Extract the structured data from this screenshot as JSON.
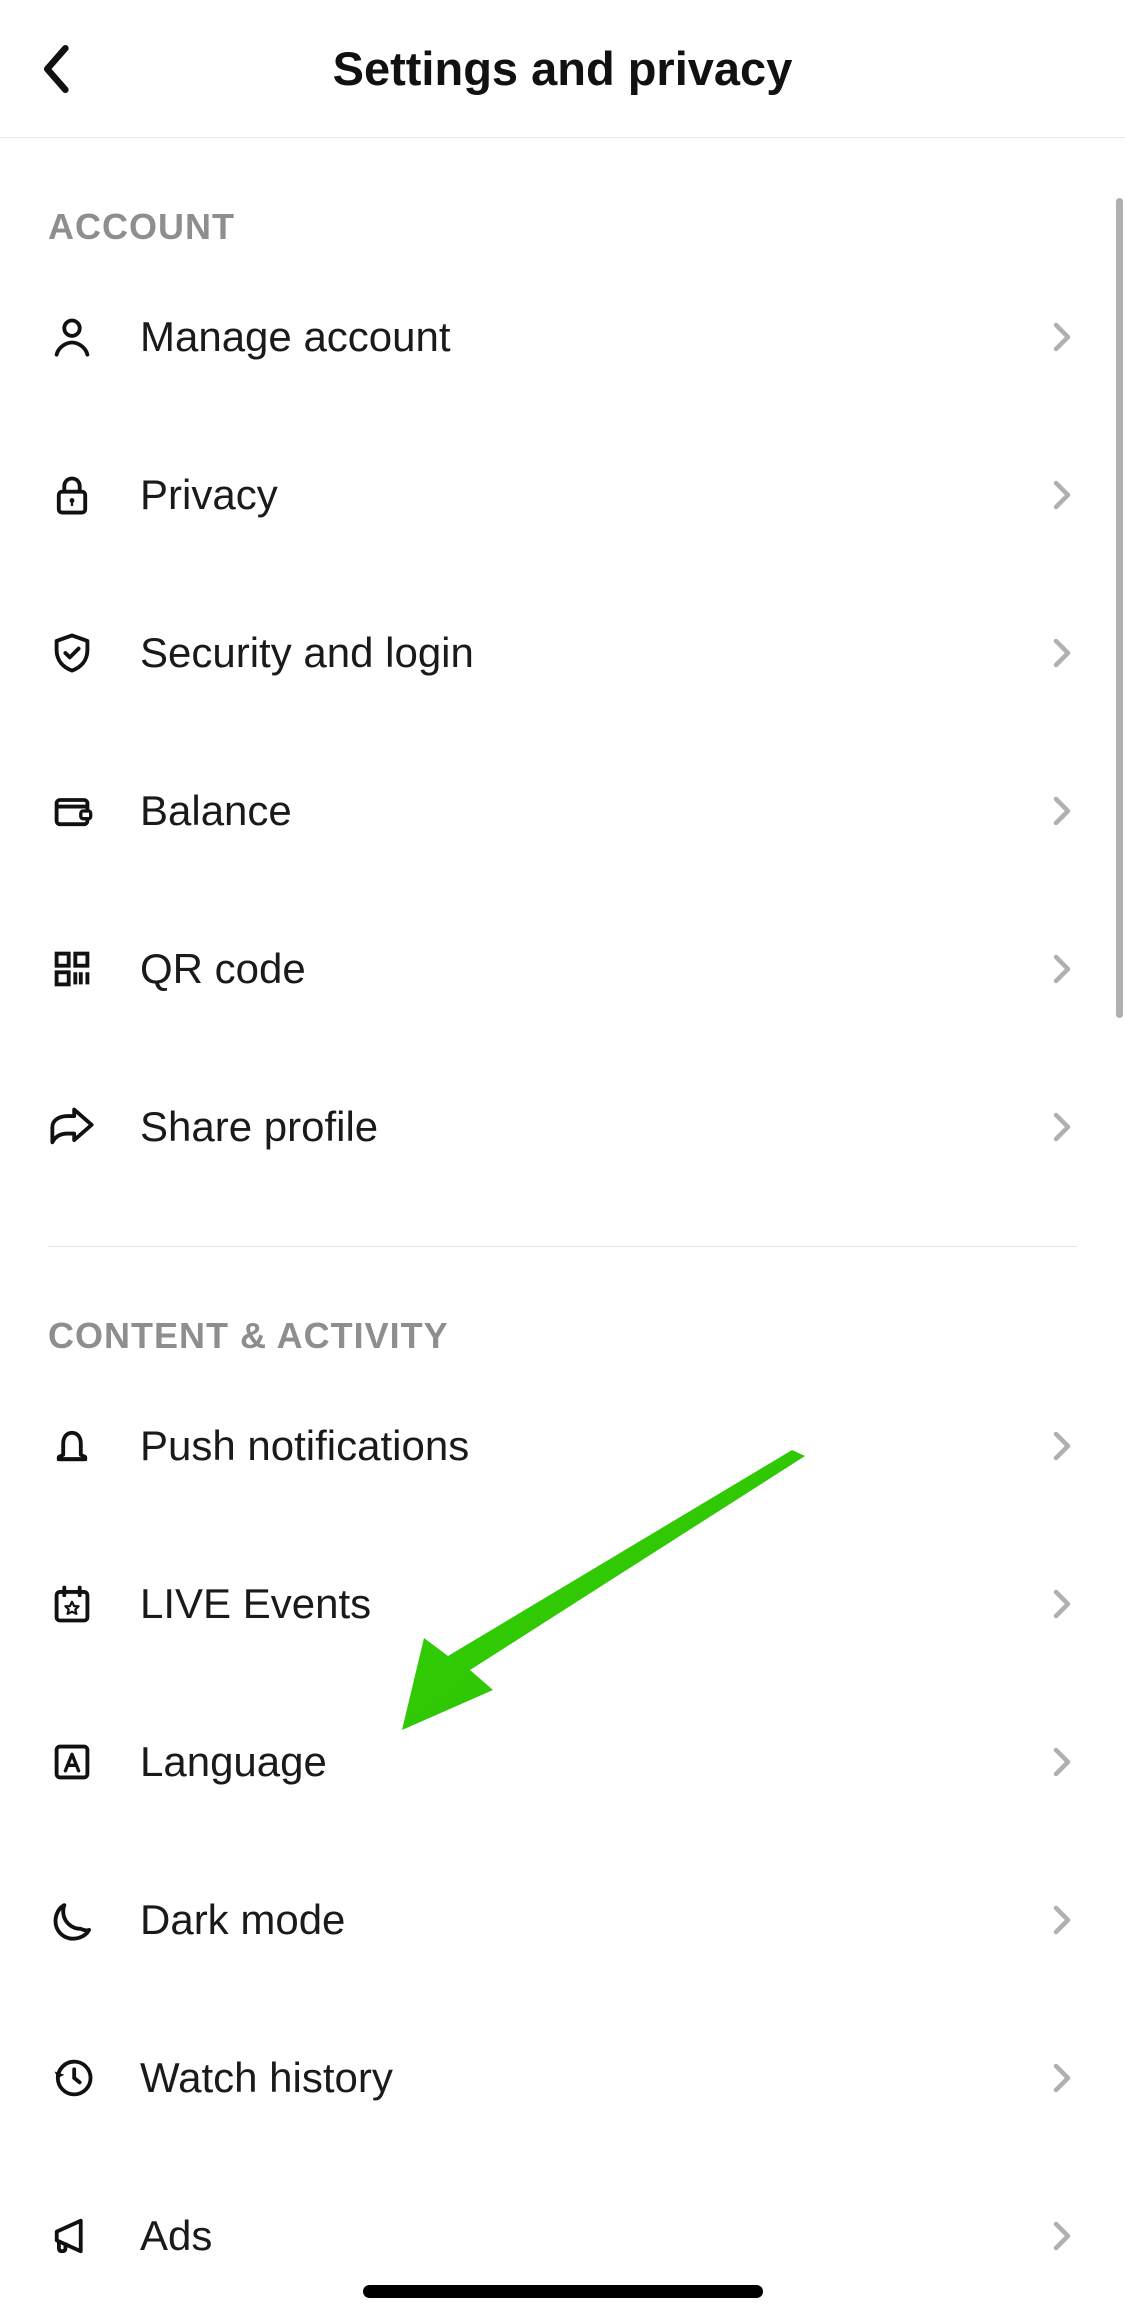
{
  "header": {
    "title": "Settings and privacy"
  },
  "sections": [
    {
      "title": "ACCOUNT",
      "items": [
        {
          "label": "Manage account",
          "icon": "person-icon"
        },
        {
          "label": "Privacy",
          "icon": "lock-icon"
        },
        {
          "label": "Security and login",
          "icon": "shield-icon"
        },
        {
          "label": "Balance",
          "icon": "wallet-icon"
        },
        {
          "label": "QR code",
          "icon": "qr-icon"
        },
        {
          "label": "Share profile",
          "icon": "share-icon"
        }
      ]
    },
    {
      "title": "CONTENT & ACTIVITY",
      "items": [
        {
          "label": "Push notifications",
          "icon": "bell-icon"
        },
        {
          "label": "LIVE Events",
          "icon": "calendar-icon"
        },
        {
          "label": "Language",
          "icon": "language-icon"
        },
        {
          "label": "Dark mode",
          "icon": "moon-icon"
        },
        {
          "label": "Watch history",
          "icon": "history-icon"
        },
        {
          "label": "Ads",
          "icon": "megaphone-icon"
        }
      ]
    }
  ],
  "annotation": {
    "arrow_color": "#35d105"
  }
}
